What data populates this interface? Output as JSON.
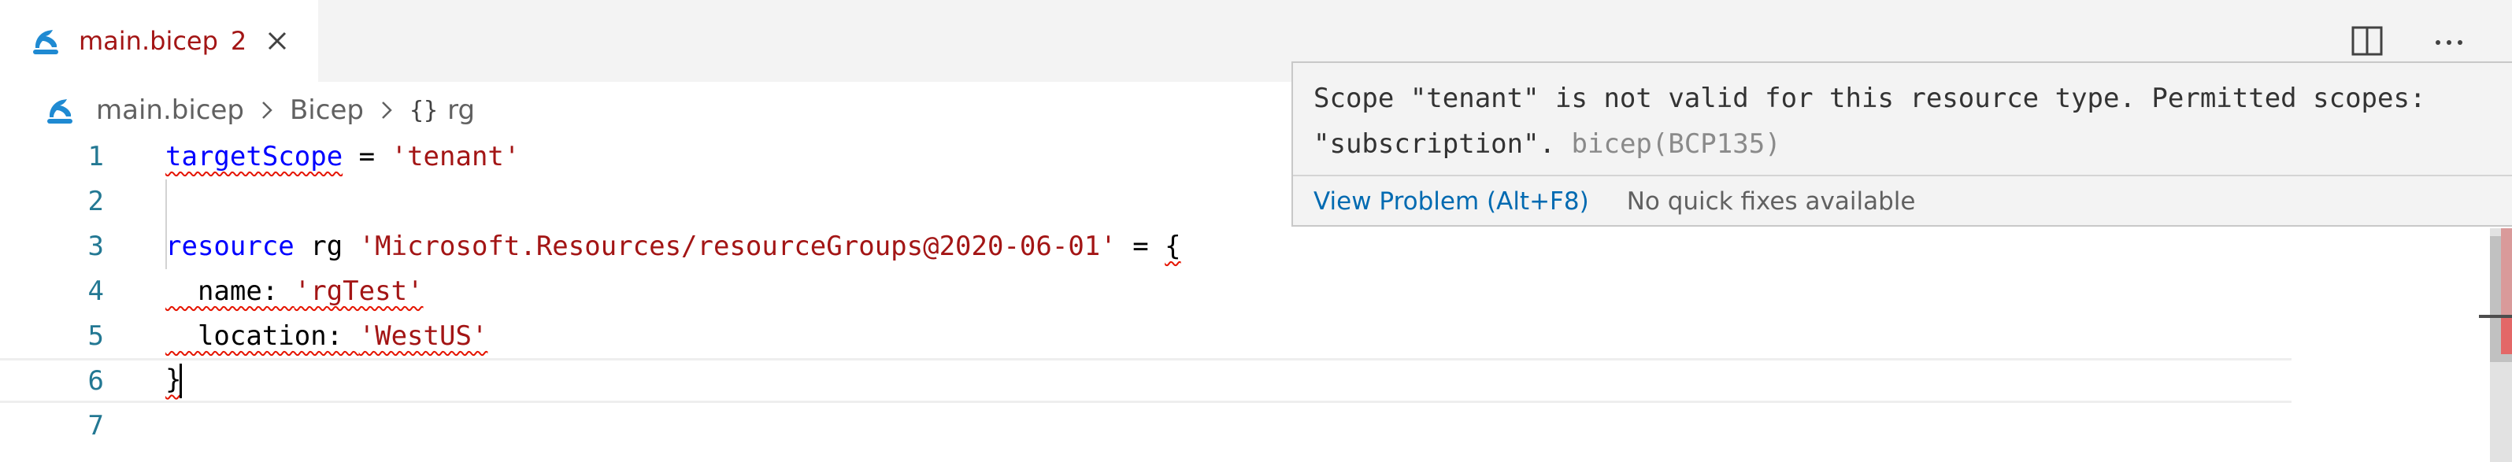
{
  "tab": {
    "filename": "main.bicep",
    "problem_count": "2",
    "icon": "bicep-arm-icon",
    "close_icon": "close-icon"
  },
  "actions": {
    "split_icon": "split-editor-icon",
    "more_icon": "more-actions-icon"
  },
  "breadcrumb": {
    "file": "main.bicep",
    "segment": "Bicep",
    "symbol_icon": "{}",
    "symbol": "rg"
  },
  "code": {
    "line_numbers": [
      "1",
      "2",
      "3",
      "4",
      "5",
      "6",
      "7"
    ],
    "l1_kw": "targetScope",
    "l1_op": " = ",
    "l1_str": "'tenant'",
    "l3_kw": "resource",
    "l3_name": " rg ",
    "l3_str": "'Microsoft.Resources/resourceGroups@2020-06-01'",
    "l3_op": " = ",
    "l3_brace": "{",
    "l4_key": "  name: ",
    "l4_str": "'rgTest'",
    "l5_key": "  location: ",
    "l5_str": "'WestUS'",
    "l6_brace": "}"
  },
  "hover": {
    "message": "Scope \"tenant\" is not valid for this resource type. Permitted scopes: \"subscription\".",
    "source": "bicep(BCP135)",
    "view_problem": "View Problem (Alt+F8)",
    "no_fixes": "No quick fixes available"
  },
  "colors": {
    "keyword": "#0000ff",
    "string": "#a31515",
    "error": "#e51400",
    "line_number": "#237893",
    "link": "#006ab1"
  }
}
